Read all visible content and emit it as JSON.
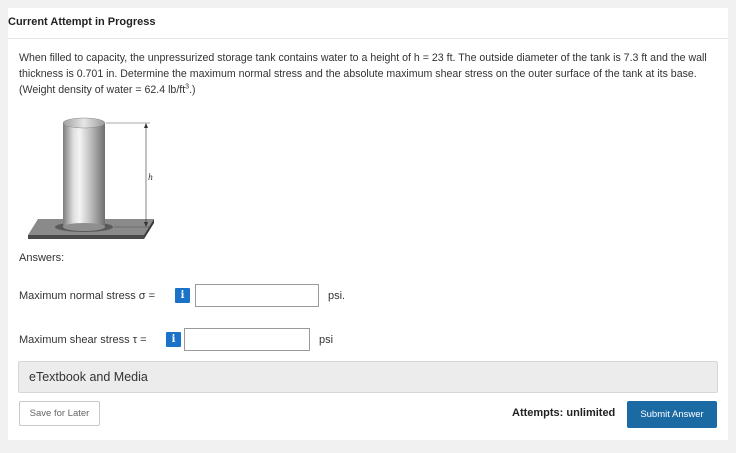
{
  "header": {
    "title": "Current Attempt in Progress"
  },
  "question": {
    "text_main": "When filled to capacity, the unpressurized storage tank contains water to a height of h = 23 ft. The outside diameter of the tank is 7.3 ft and the wall thickness is 0.701 in. Determine the maximum normal stress and the absolute maximum shear stress on the outer surface of the tank at its base. (Weight density of water = 62.4 lb/ft",
    "text_sup": "3",
    "text_end": ".)"
  },
  "figure": {
    "height_label": "h"
  },
  "answers": {
    "label": "Answers:",
    "rows": [
      {
        "label": "Maximum normal stress σ =",
        "info": "i",
        "value": "",
        "unit": "psi."
      },
      {
        "label": "Maximum shear stress τ =",
        "info": "i",
        "value": "",
        "unit": "psi"
      }
    ]
  },
  "media": {
    "label": "eTextbook and Media"
  },
  "footer": {
    "save_label": "Save for Later",
    "attempts": "Attempts: unlimited",
    "submit_label": "Submit Answer"
  },
  "colors": {
    "info": "#1a73c7",
    "submit": "#1b6aa3",
    "page_bg": "#f1f1f1"
  }
}
